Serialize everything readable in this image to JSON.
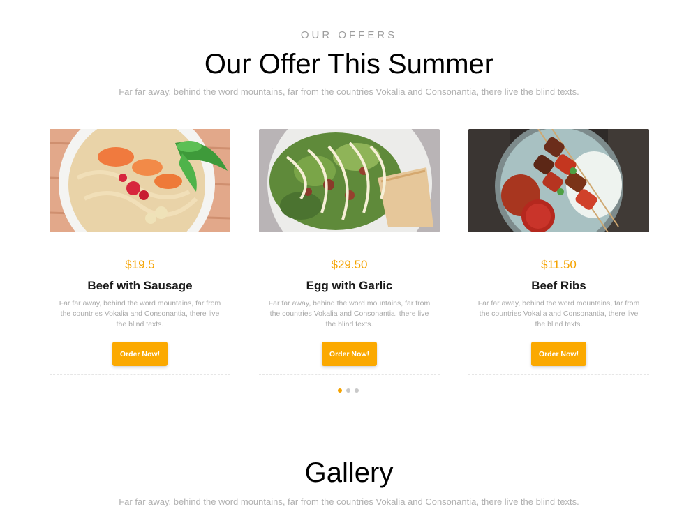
{
  "offers": {
    "eyebrow": "OUR OFFERS",
    "title": "Our Offer This Summer",
    "subtitle": "Far far away, behind the word mountains, far from the countries Vokalia and Consonantia, there live the blind texts.",
    "cards": [
      {
        "price": "$19.5",
        "name": "Beef with Sausage",
        "description": "Far far away, behind the word mountains, far from the countries Vokalia and Consonantia, there live the blind texts.",
        "button": "Order Now!"
      },
      {
        "price": "$29.50",
        "name": "Egg with Garlic",
        "description": "Far far away, behind the word mountains, far from the countries Vokalia and Consonantia, there live the blind texts.",
        "button": "Order Now!"
      },
      {
        "price": "$11.50",
        "name": "Beef Ribs",
        "description": "Far far away, behind the word mountains, far from the countries Vokalia and Consonantia, there live the blind texts.",
        "button": "Order Now!"
      }
    ],
    "carousel": {
      "total_pages": 3,
      "active_page": 1
    }
  },
  "gallery": {
    "title": "Gallery",
    "subtitle": "Far far away, behind the word mountains, far from the countries Vokalia and Consonantia, there live the blind texts."
  },
  "colors": {
    "accent": "#fba900",
    "price": "#f5a300",
    "muted_text": "#b0b0b0",
    "heading": "#000000"
  }
}
